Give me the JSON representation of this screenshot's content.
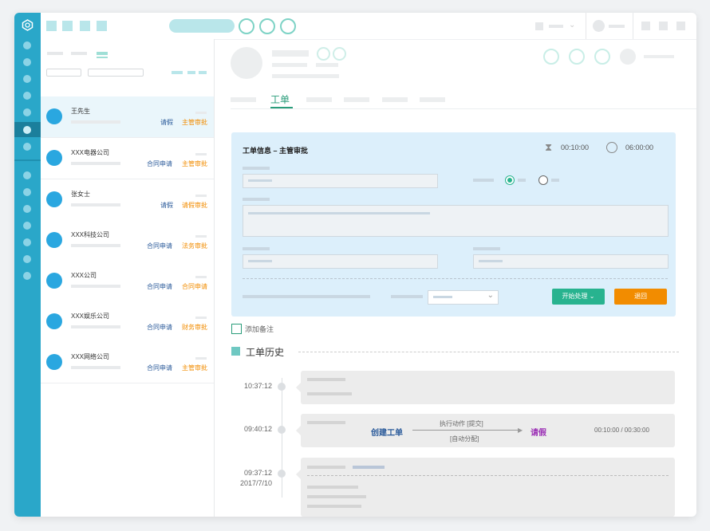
{
  "list": {
    "items": [
      {
        "name": "王先生",
        "tag1": "请假",
        "tag2": "主管审批"
      },
      {
        "name": "XXX电器公司",
        "tag1": "合同申请",
        "tag2": "主管审批"
      },
      {
        "name": "张女士",
        "tag1": "请假",
        "tag2": "请假审批"
      },
      {
        "name": "XXX科技公司",
        "tag1": "合同申请",
        "tag2": "法务审批"
      },
      {
        "name": "XXX公司",
        "tag1": "合同申请",
        "tag2": "合同申请"
      },
      {
        "name": "XXX娱乐公司",
        "tag1": "合同申请",
        "tag2": "财务审批"
      },
      {
        "name": "XXX网络公司",
        "tag1": "合同申请",
        "tag2": "主管审批"
      }
    ]
  },
  "main": {
    "active_tab": "工单",
    "panel": {
      "title": "工单信息 – 主管审批",
      "time1": "00:10:00",
      "time2": "06:00:00",
      "start_button": "开始处理",
      "return_button": "退回"
    },
    "add_note": "添加备注",
    "history_title": "工单历史",
    "history": [
      {
        "time": "10:37:12"
      },
      {
        "time": "09:40:12",
        "from": "创建工单",
        "action": "执行动作 [提交]",
        "assign": "[自动分配]",
        "to": "请假",
        "duration": "00:10:00 / 00:30:00"
      },
      {
        "time": "09:37:12",
        "date": "2017/7/10"
      }
    ]
  },
  "colors": {
    "rail": "#2aa7c9",
    "accent": "#28b38f",
    "orange": "#f28c00",
    "panel": "#dceffb"
  }
}
